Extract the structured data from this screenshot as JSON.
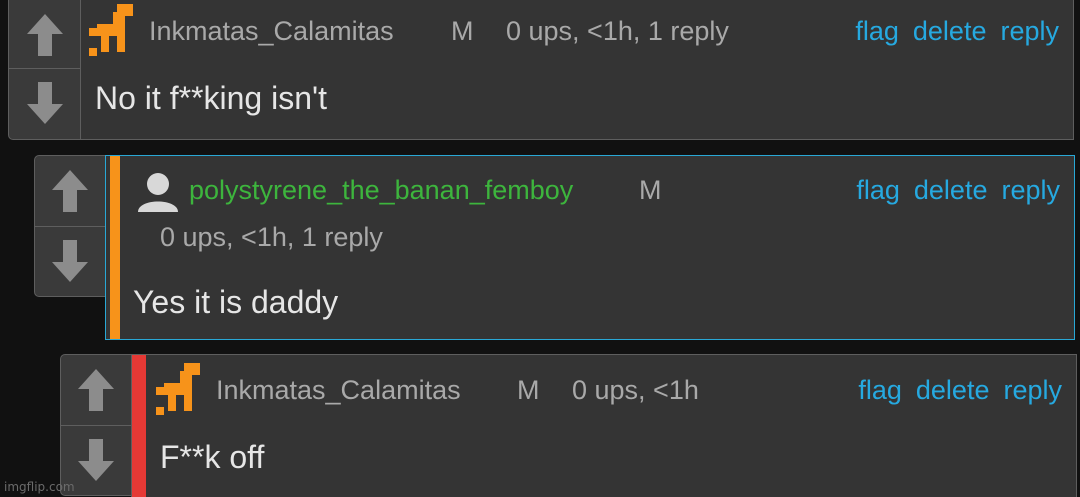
{
  "colors": {
    "link": "#26a9e0",
    "username_green": "#3db53d",
    "accent_orange": "#f7931a",
    "accent_red": "#e53935",
    "highlight_border": "#29a8d6"
  },
  "comments": [
    {
      "username": "Inkmatas_Calamitas",
      "badge": "M",
      "meta": "0 ups, <1h, 1 reply",
      "body": "No it f**king isn't",
      "avatar": "orange-dino-icon"
    },
    {
      "username": "polystyrene_the_banan_femboy",
      "badge": "M",
      "meta": "0 ups, <1h, 1 reply",
      "body": "Yes it is daddy",
      "avatar": "default-user-icon"
    },
    {
      "username": "Inkmatas_Calamitas",
      "badge": "M",
      "meta": "0 ups, <1h",
      "body": "F**k off",
      "avatar": "orange-dino-icon"
    }
  ],
  "actions": {
    "flag": "flag",
    "delete": "delete",
    "reply": "reply"
  },
  "watermark": "imgflip.com"
}
